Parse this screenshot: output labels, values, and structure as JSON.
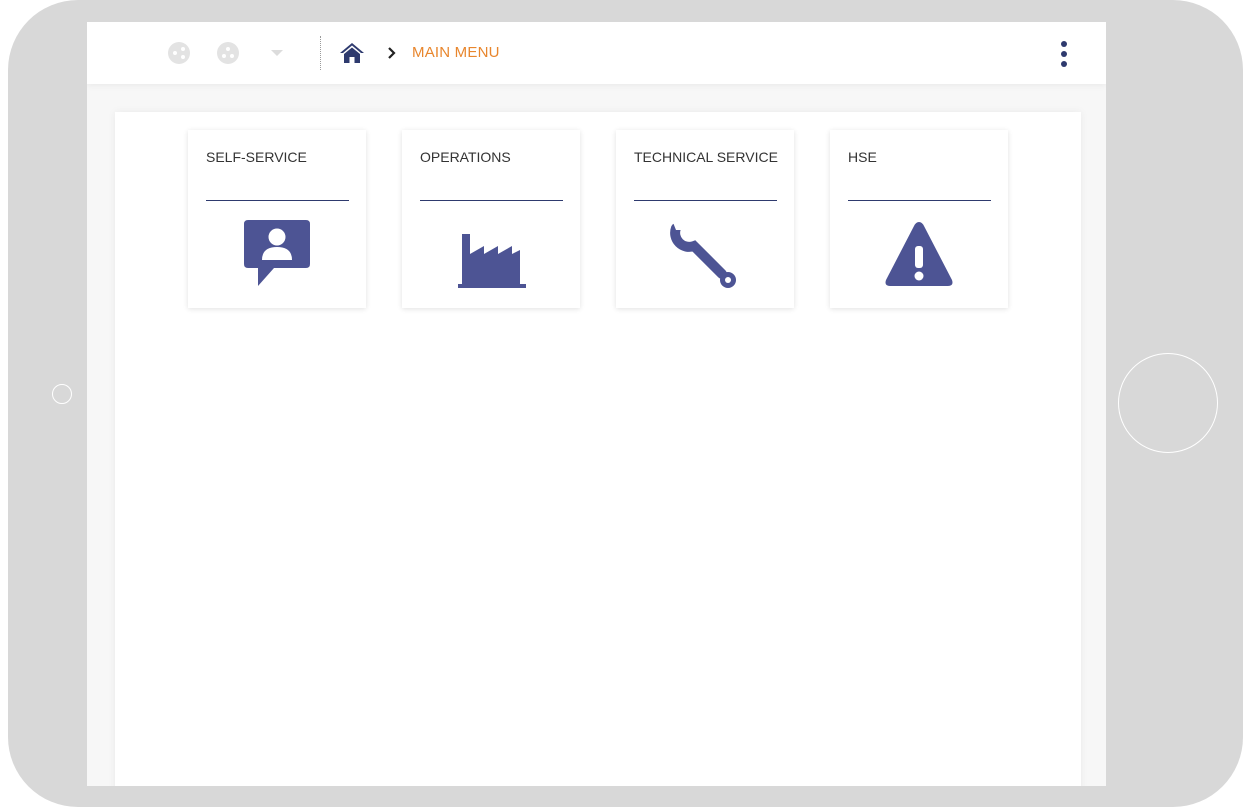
{
  "breadcrumb": {
    "home_icon": "home-icon",
    "separator_icon": "chevron-right-icon",
    "current": "MAIN MENU"
  },
  "toolbar": {
    "nav_icons": [
      "share-icon",
      "settings-icon",
      "caret-down-icon"
    ],
    "menu_icon": "kebab-menu-icon"
  },
  "tiles": [
    {
      "title": "SELF-SERVICE",
      "icon": "person-chat-icon"
    },
    {
      "title": "OPERATIONS",
      "icon": "factory-icon"
    },
    {
      "title": "TECHNICAL SERVICE",
      "icon": "wrench-icon"
    },
    {
      "title": "HSE",
      "icon": "warning-icon"
    }
  ],
  "colors": {
    "accent": "#e8862d",
    "icon": "#4d5494",
    "navy": "#2e3a6e",
    "device": "#d8d8d8"
  }
}
